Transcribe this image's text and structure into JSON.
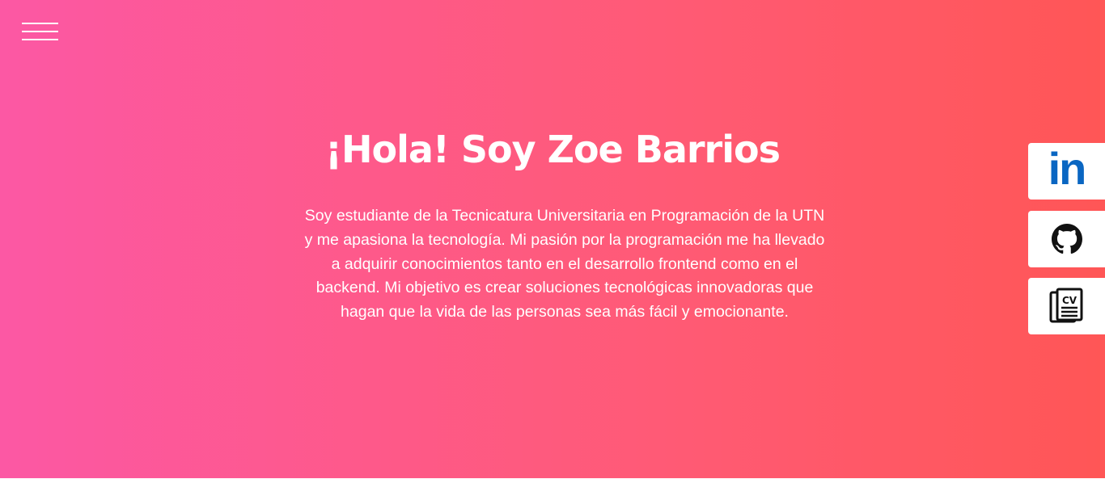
{
  "hero": {
    "title": "¡Hola! Soy Zoe Barrios",
    "description": "Soy estudiante de la Tecnicatura Universitaria en Programación de la UTN y me apasiona la tecnología. Mi pasión por la programación me ha llevado a adquirir conocimientos tanto en el desarrollo frontend como en el backend. Mi objetivo es crear soluciones tecnológicas innovadoras que hagan que la vida de las personas sea más fácil y emocionante.",
    "gradient_start": "#fc58a4",
    "gradient_end": "#ff5656"
  },
  "nav": {
    "menu_icon": "hamburger-menu-icon"
  },
  "social": {
    "linkedin": {
      "icon": "linkedin-icon",
      "label": "in",
      "color": "#0a66c2"
    },
    "github": {
      "icon": "github-icon",
      "color": "#111111"
    },
    "cv": {
      "icon": "cv-document-icon",
      "label": "CV",
      "color": "#111111"
    }
  }
}
